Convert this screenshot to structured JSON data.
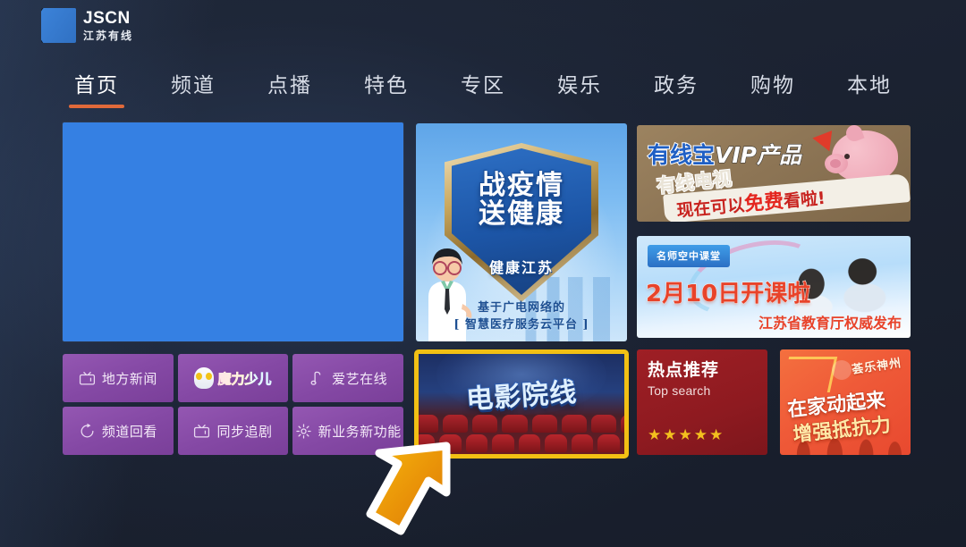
{
  "header": {
    "logo_en": "JSCN",
    "logo_cn": "江苏有线",
    "logo_icon": "jscn-swoosh-logo"
  },
  "nav": {
    "active_index": 0,
    "items": [
      {
        "label": "首页"
      },
      {
        "label": "频道"
      },
      {
        "label": "点播"
      },
      {
        "label": "特色"
      },
      {
        "label": "专区"
      },
      {
        "label": "娱乐"
      },
      {
        "label": "政务"
      },
      {
        "label": "购物"
      },
      {
        "label": "本地"
      }
    ]
  },
  "main": {
    "video_tile": {
      "name": "video-preview",
      "color": "#3580E3"
    },
    "promo_center": {
      "title_line1": "战疫情",
      "title_line2": "送健康",
      "subtitle": "健康江苏",
      "foot_line1": "基于广电网络的",
      "foot_line2": "[ 智慧医疗服务云平台 ]"
    },
    "banner_vip": {
      "brand": "有线宝",
      "brand_suffix": "VIP产品",
      "line2": "有线电视",
      "line3_prefix": "现在可以",
      "line3_highlight": "免费",
      "line3_suffix": "看啦!"
    },
    "banner_school": {
      "tag": "名师空中课堂",
      "headline": "2月10日开课啦",
      "footer": "江苏省教育厅权威发布"
    },
    "quick_buttons": [
      {
        "label": "地方新闻",
        "icon": "tv-icon"
      },
      {
        "label": "魔力少儿",
        "icon": "kids-logo"
      },
      {
        "label": "爱艺在线",
        "icon": "music-note-icon"
      },
      {
        "label": "频道回看",
        "icon": "replay-icon"
      },
      {
        "label": "同步追剧",
        "icon": "tv-icon"
      },
      {
        "label": "新业务新功能",
        "icon": "gear-icon"
      }
    ],
    "movie_card": {
      "title": "电影院线",
      "selected": true,
      "focus_color": "#F2C014"
    },
    "hot_card": {
      "title_cn": "热点推荐",
      "title_en": "Top search",
      "stars": "★★★★★",
      "rating": 5
    },
    "fitness_card": {
      "brand": "荟乐神州",
      "line1": "在家动起来",
      "line2": "增强抵抗力"
    }
  },
  "cursor": {
    "name": "pointer-arrow",
    "color": "#E8960C"
  },
  "colors": {
    "background": "#1B2231",
    "accent_orange": "#E0693A",
    "tile_blue": "#3580E3",
    "button_purple": "#8549A5",
    "focus_yellow": "#F2C014",
    "hot_red": "#8E1A20",
    "fitness_orange": "#EF5A38"
  }
}
